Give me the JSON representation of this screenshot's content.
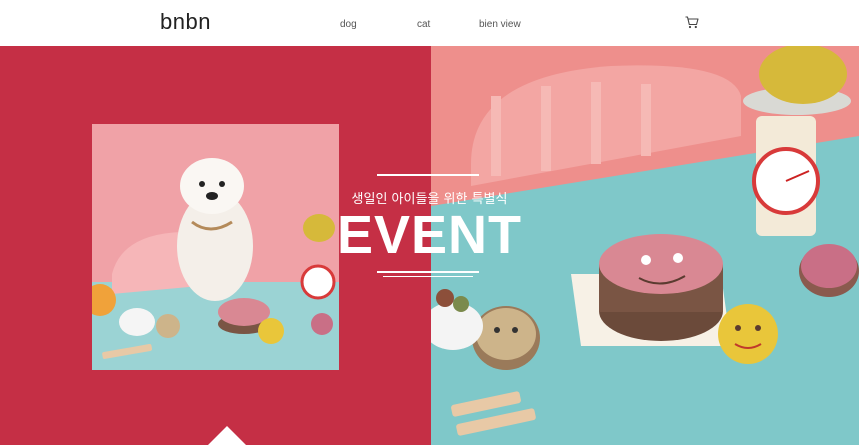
{
  "header": {
    "logo": "bnbn",
    "nav": [
      {
        "label": "dog"
      },
      {
        "label": "cat"
      },
      {
        "label": "bien view"
      }
    ],
    "cart_icon": "cart-icon"
  },
  "hero": {
    "subtitle": "생일인 아이들을 위한 특별식",
    "title": "EVENT",
    "colors": {
      "left_panel": "#c52f45",
      "right_table": "#7fc8c9",
      "right_wall": "#ee8f8c",
      "white": "#ffffff"
    }
  }
}
